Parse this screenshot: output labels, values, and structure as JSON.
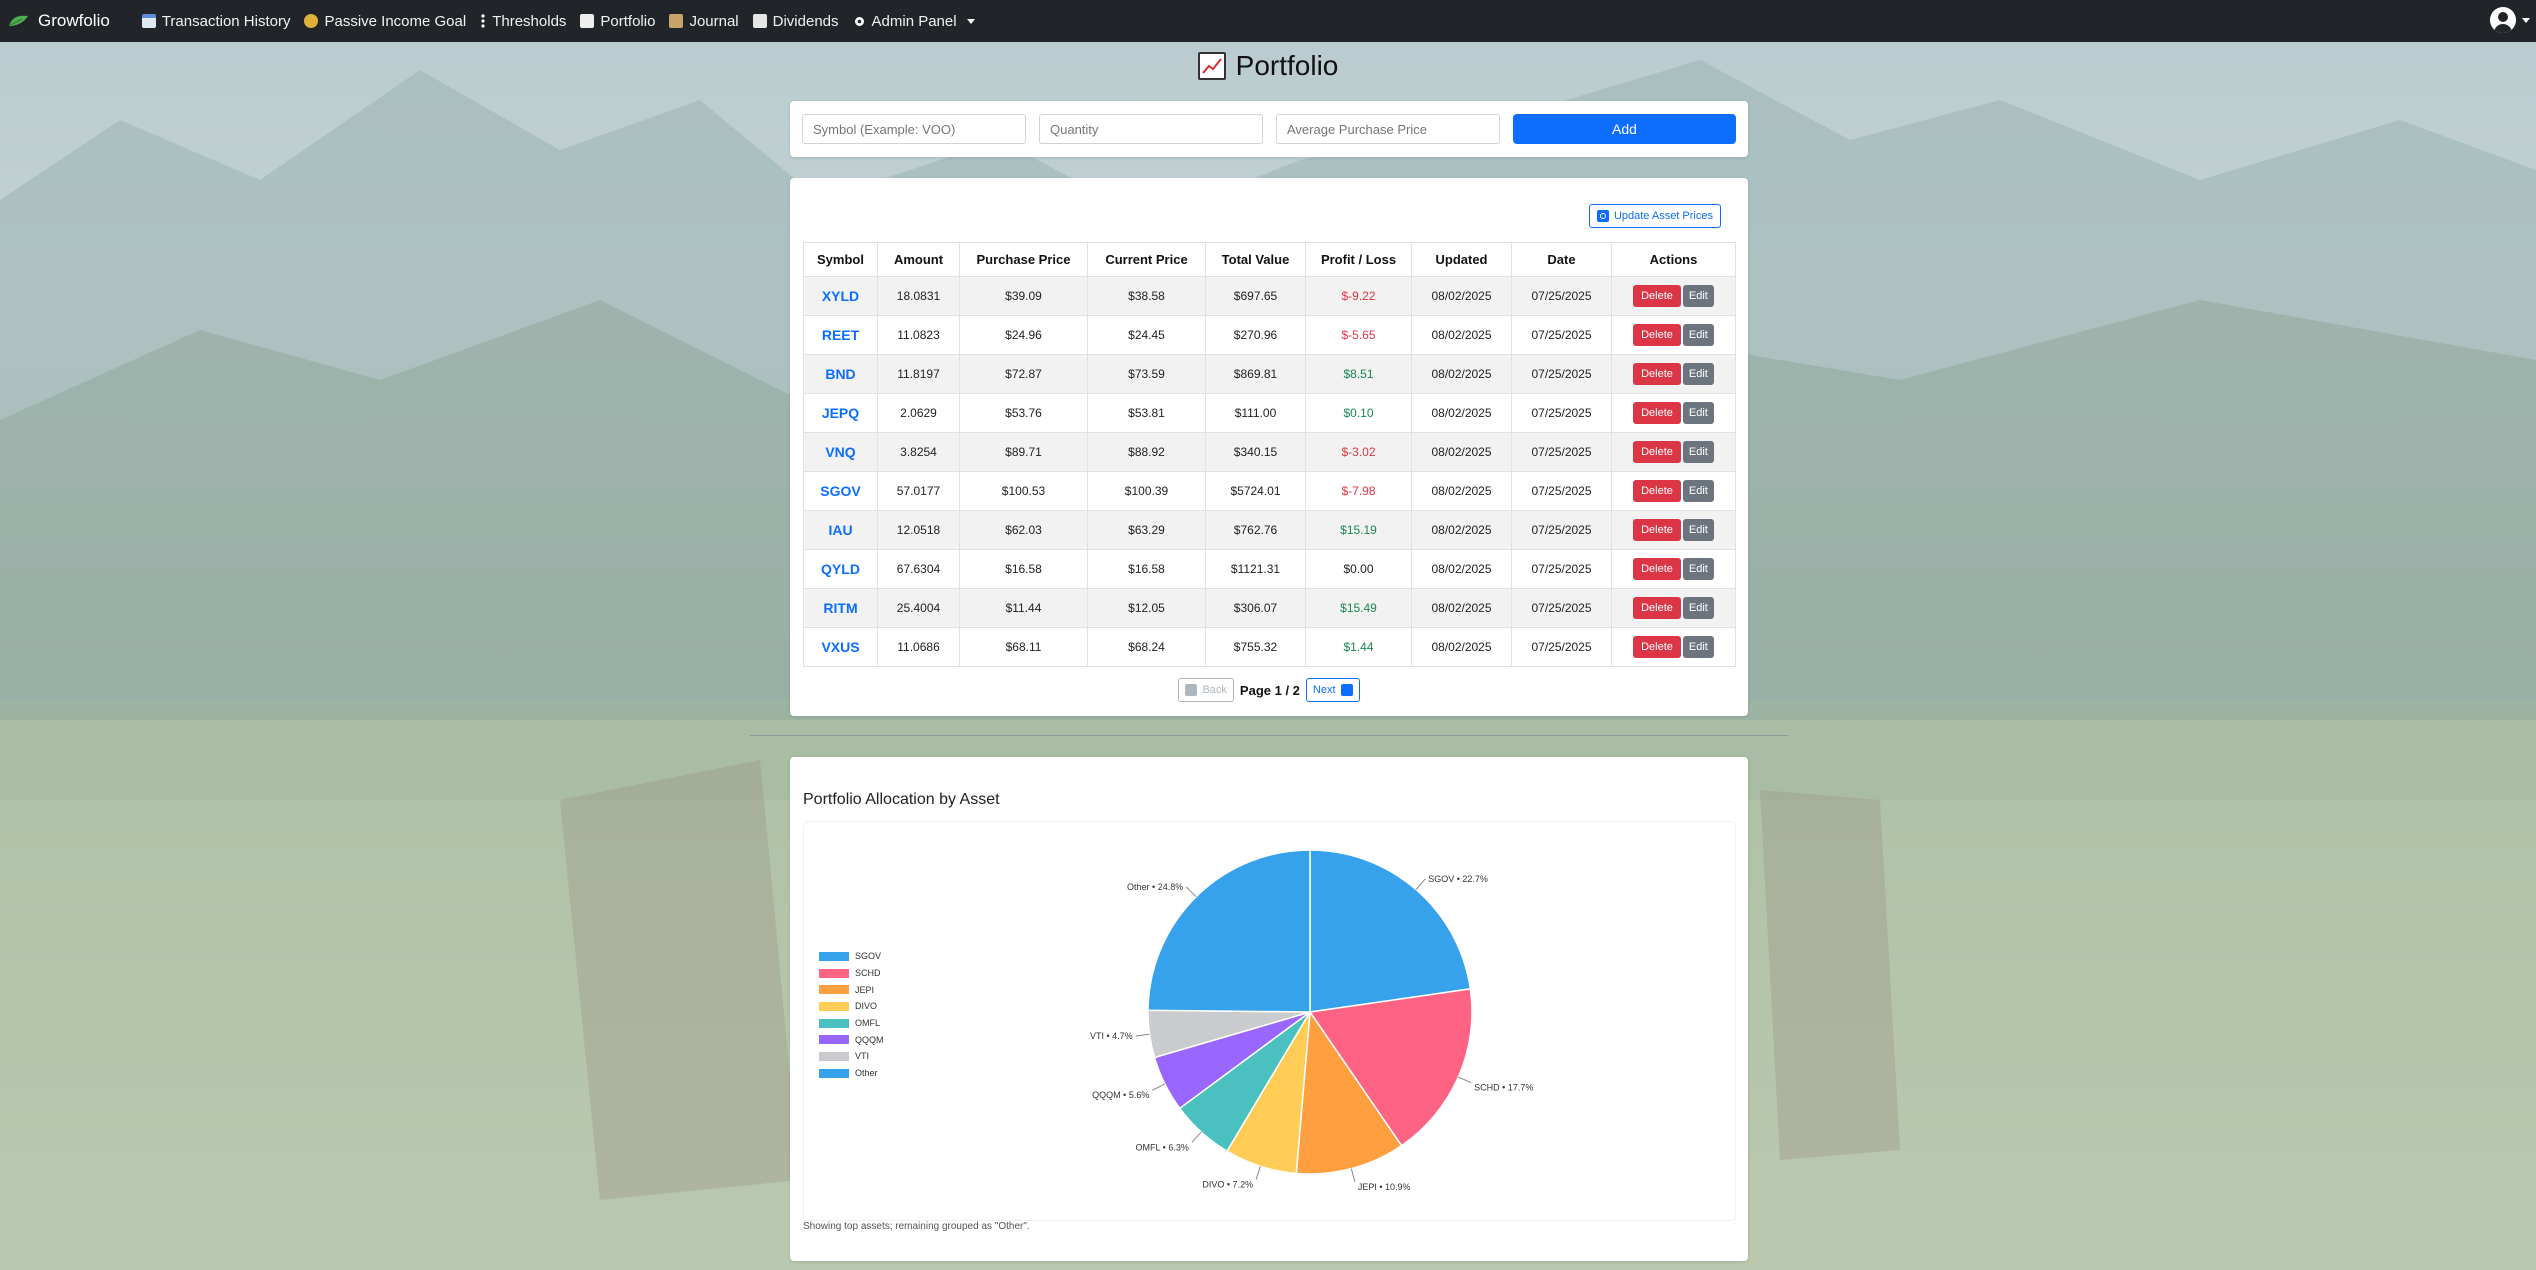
{
  "app": {
    "brand": "Growfolio"
  },
  "nav": {
    "items": [
      {
        "label": "Transaction History",
        "icon": "calendar-icon",
        "color": "#5b8ed6"
      },
      {
        "label": "Passive Income Goal",
        "icon": "coins-icon",
        "color": "#e0b13a"
      },
      {
        "label": "Thresholds",
        "icon": "vertical-dots-icon",
        "color": "#ffffff"
      },
      {
        "label": "Portfolio",
        "icon": "chart-icon",
        "color": "#dddddd"
      },
      {
        "label": "Journal",
        "icon": "notebook-icon",
        "color": "#c7a26a"
      },
      {
        "label": "Dividends",
        "icon": "book-icon",
        "color": "#dddddd"
      },
      {
        "label": "Admin Panel",
        "icon": "gear-icon",
        "color": "#ffffff"
      }
    ]
  },
  "page": {
    "title": "Portfolio"
  },
  "add_form": {
    "symbol_placeholder": "Symbol (Example: VOO)",
    "quantity_placeholder": "Quantity",
    "price_placeholder": "Average Purchase Price",
    "add_label": "Add"
  },
  "table": {
    "update_label": "Update Asset Prices",
    "headers": [
      "Symbol",
      "Amount",
      "Purchase Price",
      "Current Price",
      "Total Value",
      "Profit / Loss",
      "Updated",
      "Date",
      "Actions"
    ],
    "rows": [
      {
        "symbol": "XYLD",
        "amount": "18.0831",
        "purchase": "$39.09",
        "current": "$38.58",
        "total": "$697.65",
        "pl": "$-9.22",
        "pl_sign": "neg",
        "updated": "08/02/2025",
        "date": "07/25/2025"
      },
      {
        "symbol": "REET",
        "amount": "11.0823",
        "purchase": "$24.96",
        "current": "$24.45",
        "total": "$270.96",
        "pl": "$-5.65",
        "pl_sign": "neg",
        "updated": "08/02/2025",
        "date": "07/25/2025"
      },
      {
        "symbol": "BND",
        "amount": "11.8197",
        "purchase": "$72.87",
        "current": "$73.59",
        "total": "$869.81",
        "pl": "$8.51",
        "pl_sign": "pos",
        "updated": "08/02/2025",
        "date": "07/25/2025"
      },
      {
        "symbol": "JEPQ",
        "amount": "2.0629",
        "purchase": "$53.76",
        "current": "$53.81",
        "total": "$111.00",
        "pl": "$0.10",
        "pl_sign": "pos",
        "updated": "08/02/2025",
        "date": "07/25/2025"
      },
      {
        "symbol": "VNQ",
        "amount": "3.8254",
        "purchase": "$89.71",
        "current": "$88.92",
        "total": "$340.15",
        "pl": "$-3.02",
        "pl_sign": "neg",
        "updated": "08/02/2025",
        "date": "07/25/2025"
      },
      {
        "symbol": "SGOV",
        "amount": "57.0177",
        "purchase": "$100.53",
        "current": "$100.39",
        "total": "$5724.01",
        "pl": "$-7.98",
        "pl_sign": "neg",
        "updated": "08/02/2025",
        "date": "07/25/2025"
      },
      {
        "symbol": "IAU",
        "amount": "12.0518",
        "purchase": "$62.03",
        "current": "$63.29",
        "total": "$762.76",
        "pl": "$15.19",
        "pl_sign": "pos",
        "updated": "08/02/2025",
        "date": "07/25/2025"
      },
      {
        "symbol": "QYLD",
        "amount": "67.6304",
        "purchase": "$16.58",
        "current": "$16.58",
        "total": "$1121.31",
        "pl": "$0.00",
        "pl_sign": "zero",
        "updated": "08/02/2025",
        "date": "07/25/2025"
      },
      {
        "symbol": "RITM",
        "amount": "25.4004",
        "purchase": "$11.44",
        "current": "$12.05",
        "total": "$306.07",
        "pl": "$15.49",
        "pl_sign": "pos",
        "updated": "08/02/2025",
        "date": "07/25/2025"
      },
      {
        "symbol": "VXUS",
        "amount": "11.0686",
        "purchase": "$68.11",
        "current": "$68.24",
        "total": "$755.32",
        "pl": "$1.44",
        "pl_sign": "pos",
        "updated": "08/02/2025",
        "date": "07/25/2025"
      }
    ],
    "delete_label": "Delete",
    "edit_label": "Edit"
  },
  "pager": {
    "back_label": "Back",
    "page_text": "Page 1 / 2",
    "next_label": "Next"
  },
  "allocation": {
    "title": "Portfolio Allocation by Asset",
    "note": "Showing top assets; remaining grouped as \"Other\"."
  },
  "chart_data": {
    "type": "pie",
    "title": "Portfolio Allocation by Asset",
    "legend_position": "left",
    "categories": [
      "SGOV",
      "SCHD",
      "JEPI",
      "DIVO",
      "OMFL",
      "QQQM",
      "VTI",
      "Other"
    ],
    "values": [
      22.7,
      17.7,
      10.9,
      7.2,
      6.3,
      5.6,
      4.7,
      24.8
    ],
    "slice_labels": [
      "SGOV • 22.7%",
      "SCHD • 17.7%",
      "JEPI • 10.9%",
      "DIVO • 7.2%",
      "OMFL • 6.3%",
      "QQQM • 5.6%",
      "VTI • 4.7%",
      "Other • 24.8%"
    ],
    "colors": [
      "#36a2eb",
      "#ff6384",
      "#ff9f40",
      "#ffcd56",
      "#4bc0c0",
      "#9966ff",
      "#c9cbcf",
      "#36a2eb"
    ]
  }
}
